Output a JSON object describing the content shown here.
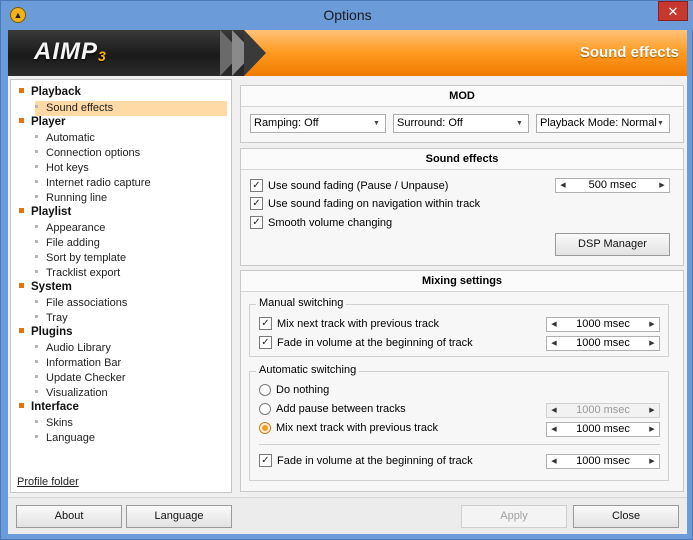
{
  "window": {
    "title": "Options",
    "close_label": "✕"
  },
  "banner": {
    "logo": "AIMP",
    "logo_version": "3",
    "title": "Sound effects"
  },
  "sidebar": {
    "categories": [
      {
        "label": "Playback",
        "items": [
          "Sound effects"
        ]
      },
      {
        "label": "Player",
        "items": [
          "Automatic",
          "Connection options",
          "Hot keys",
          "Internet radio capture",
          "Running line"
        ]
      },
      {
        "label": "Playlist",
        "items": [
          "Appearance",
          "File adding",
          "Sort by template",
          "Tracklist export"
        ]
      },
      {
        "label": "System",
        "items": [
          "File associations",
          "Tray"
        ]
      },
      {
        "label": "Plugins",
        "items": [
          "Audio Library",
          "Information Bar",
          "Update Checker",
          "Visualization"
        ]
      },
      {
        "label": "Interface",
        "items": [
          "Skins",
          "Language"
        ]
      }
    ],
    "selected": "Sound effects",
    "profile_folder": "Profile folder"
  },
  "mod": {
    "title": "MOD",
    "ramping": "Ramping: Off",
    "surround": "Surround: Off",
    "playback_mode": "Playback Mode: Normal"
  },
  "sound_effects": {
    "title": "Sound effects",
    "fading": {
      "label": "Use sound fading (Pause / Unpause)",
      "checked": true,
      "value": "500 msec"
    },
    "fading_nav": {
      "label": "Use sound fading on navigation within track",
      "checked": true
    },
    "smooth": {
      "label": "Smooth volume changing",
      "checked": true
    },
    "dsp_button": "DSP Manager"
  },
  "mixing": {
    "title": "Mixing settings",
    "manual": {
      "label": "Manual switching",
      "mix": {
        "label": "Mix next track with previous track",
        "checked": true,
        "value": "1000 msec"
      },
      "fade": {
        "label": "Fade in volume at the beginning of track",
        "checked": true,
        "value": "1000 msec"
      }
    },
    "auto": {
      "label": "Automatic switching",
      "nothing": {
        "label": "Do nothing",
        "selected": false
      },
      "pause": {
        "label": "Add pause between tracks",
        "selected": false,
        "value": "1000 msec"
      },
      "mix": {
        "label": "Mix next track with previous track",
        "selected": true,
        "value": "1000 msec"
      },
      "fade": {
        "label": "Fade in volume at the beginning of track",
        "checked": true,
        "value": "1000 msec"
      }
    }
  },
  "buttons": {
    "about": "About",
    "language": "Language",
    "apply": "Apply",
    "close": "Close"
  },
  "colors": {
    "accent": "#ff9a1f",
    "selection": "#ffd9a6",
    "titlebar": "#6b9bd8"
  }
}
